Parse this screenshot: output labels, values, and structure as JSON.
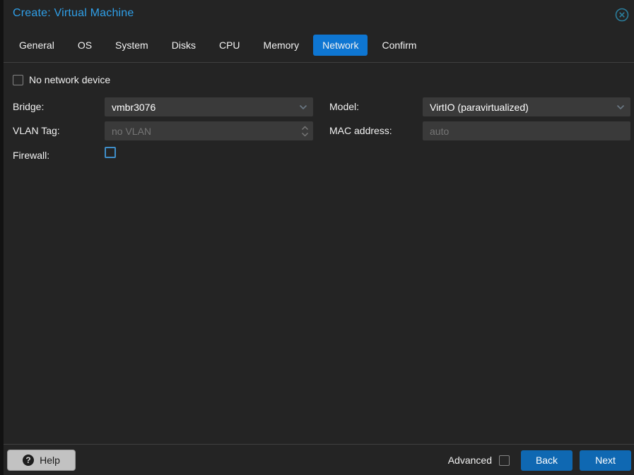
{
  "window": {
    "title": "Create: Virtual Machine",
    "close_icon": "circled-x"
  },
  "tabs": [
    "General",
    "OS",
    "System",
    "Disks",
    "CPU",
    "Memory",
    "Network",
    "Confirm"
  ],
  "active_tab": "Network",
  "form": {
    "no_network_device": {
      "label": "No network device",
      "checked": false
    },
    "bridge": {
      "label": "Bridge:",
      "value": "vmbr3076",
      "type": "combo"
    },
    "model": {
      "label": "Model:",
      "value": "VirtIO (paravirtualized)",
      "type": "combo"
    },
    "vlan": {
      "label": "VLAN Tag:",
      "value": "",
      "placeholder": "no VLAN",
      "type": "number-spinner"
    },
    "mac": {
      "label": "MAC address:",
      "value": "",
      "placeholder": "auto",
      "type": "text"
    },
    "firewall": {
      "label": "Firewall:",
      "checked": false,
      "type": "checkbox"
    }
  },
  "footer": {
    "help": "Help",
    "help_icon": "question-mark-circle",
    "advanced": "Advanced",
    "advanced_checked": false,
    "back": "Back",
    "next": "Next"
  },
  "icons": {
    "combo_trigger": "chevron-down",
    "spinner_trigger": "up-down-chevrons"
  },
  "colors": {
    "dialog_bg": "#242424",
    "backdrop": "#121212",
    "title_blue": "#2f9fe8",
    "active_tab_blue": "#0e76d2",
    "button_blue": "#0f68b2",
    "input_bg": "#3a3a3a",
    "placeholder_grey": "#757575",
    "firewall_checkbox_border": "#3f8ec9",
    "close_icon_teal": "#2b7e9d",
    "divider": "#3f3f3f"
  }
}
